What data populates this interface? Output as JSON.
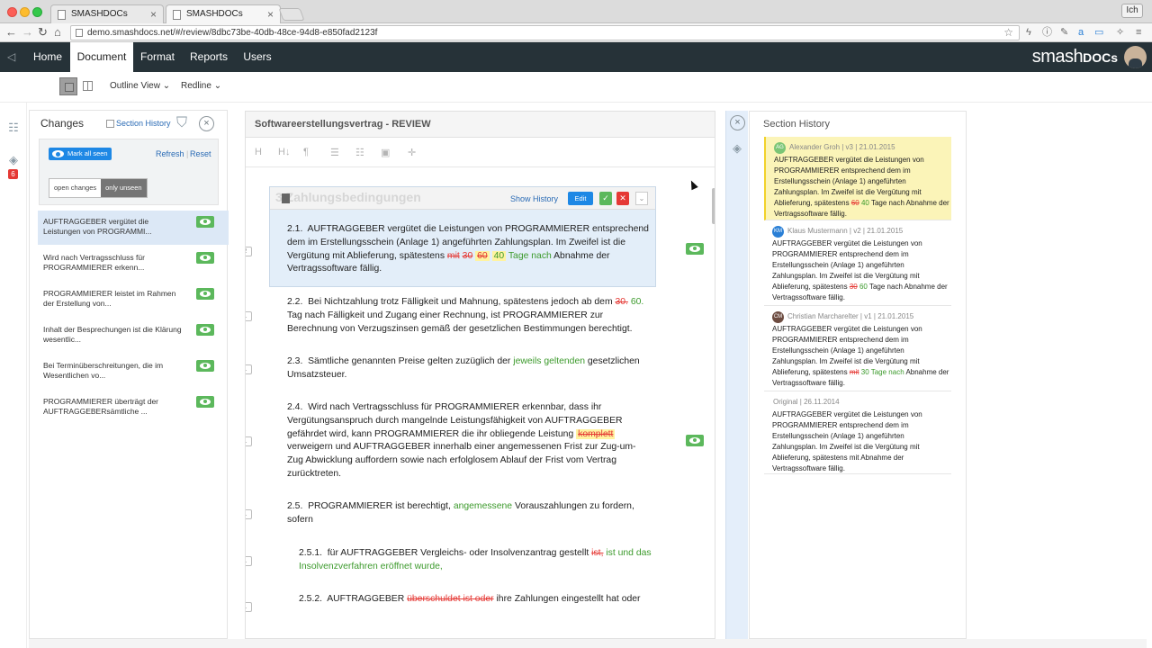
{
  "browser": {
    "tabs": [
      {
        "label": "SMASHDOCs",
        "active": false
      },
      {
        "label": "SMASHDOCs",
        "active": true
      }
    ],
    "user": "Ich",
    "url": "demo.smashdocs.net/#/review/8dbc73be-40db-48ce-94d8-e850fad2123f"
  },
  "app": {
    "menu": [
      "Home",
      "Document",
      "Format",
      "Reports",
      "Users"
    ],
    "active_menu": "Document",
    "brand_main": "smash",
    "brand_bold": "DOCs"
  },
  "toolbar": {
    "outline_view": "Outline View",
    "redline": "Redline"
  },
  "left_rail": {
    "badge": "6"
  },
  "changes_panel": {
    "title": "Changes",
    "section_history_label": "Section History",
    "mark_all_seen": "Mark all seen",
    "refresh": "Refresh",
    "reset": "Reset",
    "filter_open": "open changes",
    "filter_unseen": "only unseen",
    "items": [
      {
        "line1": "AUFTRAGGEBER vergütet die",
        "line2": "Leistungen von PROGRAMMI..."
      },
      {
        "line1": "Wird nach Vertragsschluss für",
        "line2": "PROGRAMMIERER erkenn..."
      },
      {
        "line1": "PROGRAMMIERER leistet im Rahmen",
        "line2": "der Erstellung von..."
      },
      {
        "line1": "Inhalt der Besprechungen ist die Klärung",
        "line2": "wesentlic..."
      },
      {
        "line1": "Bei Terminüberschreitungen, die im",
        "line2": "Wesentlichen vo..."
      },
      {
        "line1": "PROGRAMMIERER überträgt der",
        "line2": "AUFTRAGGEBERsämtliche ..."
      }
    ]
  },
  "document": {
    "title": "Softwareerstellungsvertrag - REVIEW",
    "tools": [
      "H",
      "H↓",
      "¶",
      "☰",
      "☷",
      "▣",
      "✛"
    ],
    "section_watermark": "3  Zahlungsbedingungen",
    "show_history": "Show History",
    "edit": "Edit",
    "p21": {
      "num": "2.1.",
      "text_a": "AUFTRAGGEBER vergütet die Leistungen von PROGRAMMIERER entsprechend dem im Erstellungsschein (Anlage 1) angeführten Zahlungsplan. Im Zweifel ist die Vergütung mit Ablieferung, spätestens",
      "del1": "mit",
      "del2": "30",
      "del3": "60",
      "ins1": "40",
      "ins2": "Tage nach",
      "text_b": "Abnahme der Vertragssoftware fällig.",
      "versions": "2"
    },
    "p22": {
      "num": "2.2.",
      "text_a": "Bei Nichtzahlung trotz Fälligkeit und Mahnung, spätestens jedoch ab dem",
      "del1": "30.",
      "ins1": "60.",
      "text_b": "Tag nach Fälligkeit und Zugang einer Rechnung, ist PROGRAMMIERER zur Berechnung von Verzugszinsen gemäß der gesetzlichen Bestimmungen berechtigt.",
      "versions": "1"
    },
    "p23": {
      "num": "2.3.",
      "text_a": "Sämtliche genannten Preise gelten zuzüglich der",
      "ins1": "jeweils geltenden",
      "text_b": "gesetzlichen Umsatzsteuer.",
      "versions": "1"
    },
    "p24": {
      "num": "2.4.",
      "text_a": "Wird nach Vertragsschluss für PROGRAMMIERER erkennbar, dass ihr Vergütungsanspruch durch mangelnde Leistungsfähigkeit von AUFTRAGGEBER gefährdet wird, kann PROGRAMMIERER die ihr obliegende Leistung",
      "del1": "komplett",
      "text_b": "verweigern und AUFTRAGGEBER innerhalb einer angemessenen Frist zur Zug-um-Zug Abwicklung auffordern sowie nach erfolglosem Ablauf der Frist vom Vertrag zurücktreten.",
      "versions": "1"
    },
    "p25": {
      "num": "2.5.",
      "text_a": "PROGRAMMIERER ist berechtigt,",
      "ins1": "angemessene",
      "text_b": "Vorauszahlungen zu fordern, sofern",
      "versions": "1"
    },
    "p251": {
      "num": "2.5.1.",
      "text_a": "für AUFTRAGGEBER Vergleichs- oder Insolvenzantrag gestellt",
      "del1": "ist,",
      "ins1": "ist und das Insolvenzverfahren eröffnet wurde,",
      "versions": "1"
    },
    "p252": {
      "num": "2.5.2.",
      "text_a": "AUFTRAGGEBER",
      "del1": "überschuldet ist oder",
      "text_b": "ihre Zahlungen eingestellt hat oder",
      "versions": "1"
    }
  },
  "history": {
    "title": "Section History",
    "entries": [
      {
        "initials": "AG",
        "meta": "Alexander Groh | v3 | 21.01.2015",
        "text_a": "AUFTRAGGEBER vergütet die Leistungen von PROGRAMMIERER entsprechend dem im Erstellungsschein (Anlage 1) angeführten Zahlungsplan. Im Zweifel ist die Vergütung mit Ablieferung, spätestens",
        "del": "60",
        "ins": "40",
        "text_b": "Tage nach Abnahme der Vertragssoftware fällig."
      },
      {
        "initials": "KM",
        "meta": "Klaus Mustermann | v2 | 21.01.2015",
        "text_a": "AUFTRAGGEBER vergütet die Leistungen von PROGRAMMIERER entsprechend dem im Erstellungsschein (Anlage 1) angeführten Zahlungsplan. Im Zweifel ist die Vergütung mit Ablieferung, spätestens",
        "del": "30",
        "ins": "60",
        "text_b": "Tage nach Abnahme der Vertragssoftware fällig."
      },
      {
        "initials": "CM",
        "meta": "Christian Marcharelter | v1 | 21.01.2015",
        "text_a": "AUFTRAGGEBER vergütet die Leistungen von PROGRAMMIERER entsprechend dem im Erstellungsschein (Anlage 1) angeführten Zahlungsplan. Im Zweifel ist die Vergütung mit Ablieferung, spätestens",
        "del": "mit",
        "ins": "30 Tage nach",
        "text_b": "Abnahme der Vertragssoftware fällig."
      },
      {
        "meta": "Original | 26.11.2014",
        "text_a": "AUFTRAGGEBER vergütet die Leistungen von PROGRAMMIERER entsprechend dem im Erstellungsschein (Anlage 1) angeführten Zahlungsplan. Im Zweifel ist die Vergütung mit Ablieferung, spätestens mit Abnahme der Vertragssoftware fällig."
      }
    ]
  },
  "colors": {
    "nav_bg": "#263238",
    "accent_blue": "#1e88e5",
    "seen_green": "#5cb85c",
    "deleted_red": "#e53935",
    "inserted_green": "#3c9a2c",
    "current_version_yellow": "#fbf4b8"
  }
}
